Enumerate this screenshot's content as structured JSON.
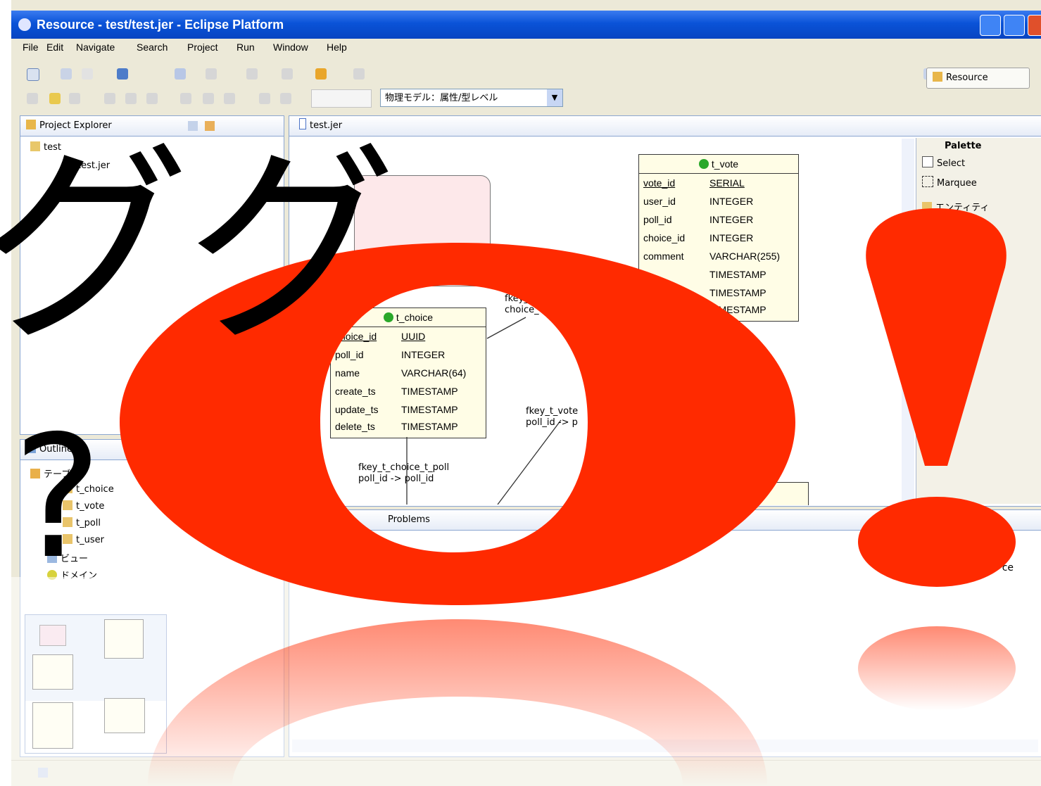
{
  "window": {
    "title": "Resource - test/test.jer - Eclipse Platform"
  },
  "menu": [
    "File",
    "Edit",
    "Navigate",
    "Search",
    "Project",
    "Run",
    "Window",
    "Help"
  ],
  "toolbar": {
    "mode_combo": "物理モデル：属性/型レベル",
    "perspective": "Resource"
  },
  "project_explorer": {
    "tab": "Project Explorer",
    "items": [
      "test",
      "test.jer"
    ]
  },
  "editor": {
    "tab": "test.jer"
  },
  "palette": {
    "title": "Palette",
    "items": [
      "Select",
      "Marquee",
      "エンティティ"
    ]
  },
  "outline": {
    "tab": "Outline",
    "items": [
      "テーブル",
      "t_choice",
      "t_vote",
      "t_poll",
      "t_user",
      "ビュー",
      "ドメイン"
    ]
  },
  "problems": {
    "tab": "Problems",
    "col": "ce"
  },
  "tables": {
    "t_vote": {
      "name": "t_vote",
      "rows": [
        [
          "vote_id",
          "SERIAL"
        ],
        [
          "user_id",
          "INTEGER"
        ],
        [
          "poll_id",
          "INTEGER"
        ],
        [
          "choice_id",
          "INTEGER"
        ],
        [
          "comment",
          "VARCHAR(255)"
        ],
        [
          "",
          "TIMESTAMP"
        ],
        [
          "",
          "TIMESTAMP"
        ],
        [
          "",
          "TIMESTAMP"
        ]
      ]
    },
    "t_choice": {
      "name": "t_choice",
      "rows": [
        [
          "choice_id",
          "UUID"
        ],
        [
          "poll_id",
          "INTEGER"
        ],
        [
          "name",
          "VARCHAR(64)"
        ],
        [
          "create_ts",
          "TIMESTAMP"
        ],
        [
          "update_ts",
          "TIMESTAMP"
        ],
        [
          "delete_ts",
          "TIMESTAMP"
        ]
      ]
    }
  },
  "relations": {
    "r1": [
      "fkey_t_choice_t_poll",
      "poll_id -> poll_id"
    ],
    "r2": [
      "fkey_t_vote",
      "poll_id -> p"
    ],
    "r3": [
      "fkey_t",
      "choice_"
    ]
  },
  "overlay": {
    "katakana": "ググ",
    "question": "?",
    "big_o": "O",
    "exclaim": "!",
    "colors": {
      "red": "#ff2a00",
      "text": "#000000"
    }
  }
}
